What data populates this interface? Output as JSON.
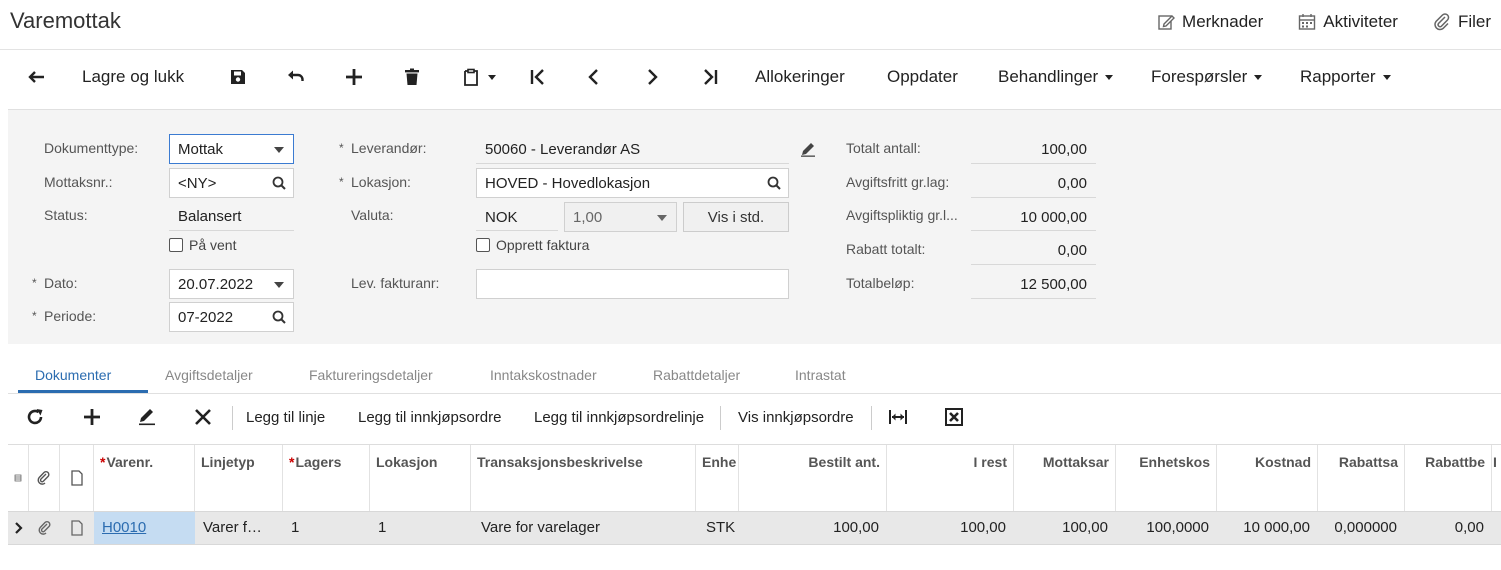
{
  "page": {
    "title": "Varemottak"
  },
  "top_actions": [
    {
      "label": "Merknader",
      "icon": "edit-note-icon"
    },
    {
      "label": "Aktiviteter",
      "icon": "calendar-icon"
    },
    {
      "label": "Filer",
      "icon": "paperclip-icon"
    }
  ],
  "toolbar": {
    "save_close": "Lagre og lukk",
    "allokeringer": "Allokeringer",
    "oppdater": "Oppdater",
    "behandlinger": "Behandlinger",
    "foresporsler": "Forespørsler",
    "rapporter": "Rapporter"
  },
  "form": {
    "dokumenttype_label": "Dokumenttype:",
    "dokumenttype_value": "Mottak",
    "mottaksnr_label": "Mottaksnr.:",
    "mottaksnr_value": "<NY>",
    "status_label": "Status:",
    "status_value": "Balansert",
    "paa_vent_label": "På vent",
    "dato_label": "Dato:",
    "dato_value": "20.07.2022",
    "periode_label": "Periode:",
    "periode_value": "07-2022",
    "leverandor_label": "Leverandør:",
    "leverandor_value": "50060 - Leverandør AS",
    "lokasjon_label": "Lokasjon:",
    "lokasjon_value": "HOVED - Hovedlokasjon",
    "valuta_label": "Valuta:",
    "valuta_value": "NOK",
    "rate_value": "1,00",
    "vis_std_label": "Vis i std.",
    "opprett_faktura_label": "Opprett faktura",
    "lev_fakturanr_label": "Lev. fakturanr:",
    "lev_fakturanr_value": ""
  },
  "totals": [
    {
      "label": "Totalt antall:",
      "value": "100,00"
    },
    {
      "label": "Avgiftsfritt gr.lag:",
      "value": "0,00"
    },
    {
      "label": "Avgiftspliktig gr.l...",
      "value": "10 000,00"
    },
    {
      "label": "Rabatt totalt:",
      "value": "0,00"
    },
    {
      "label": "Totalbeløp:",
      "value": "12 500,00"
    }
  ],
  "tabs": [
    "Dokumenter",
    "Avgiftsdetaljer",
    "Faktureringsdetaljer",
    "Inntakskostnader",
    "Rabattdetaljer",
    "Intrastat"
  ],
  "grid_toolbar": {
    "legg_til_linje": "Legg til linje",
    "legg_til_innkjopsordre": "Legg til innkjøpsordre",
    "legg_til_innkjopsordrelinje": "Legg til innkjøpsordrelinje",
    "vis_innkjopsordre": "Vis innkjøpsordre"
  },
  "grid": {
    "columns": [
      "Varenr.",
      "Linjetyp",
      "Lagers",
      "Lokasjon",
      "Transaksjonsbeskrivelse",
      "Enhe",
      "Bestilt ant.",
      "I rest",
      "Mottaksar",
      "Enhetskos",
      "Kostnad",
      "Rabattsa",
      "Rabattbe",
      "I"
    ],
    "rows": [
      [
        "H0010",
        "Varer f…",
        "1",
        "1",
        "Vare for varelager",
        "STK",
        "100,00",
        "100,00",
        "100,00",
        "100,0000",
        "10 000,00",
        "0,000000",
        "0,00"
      ]
    ]
  }
}
